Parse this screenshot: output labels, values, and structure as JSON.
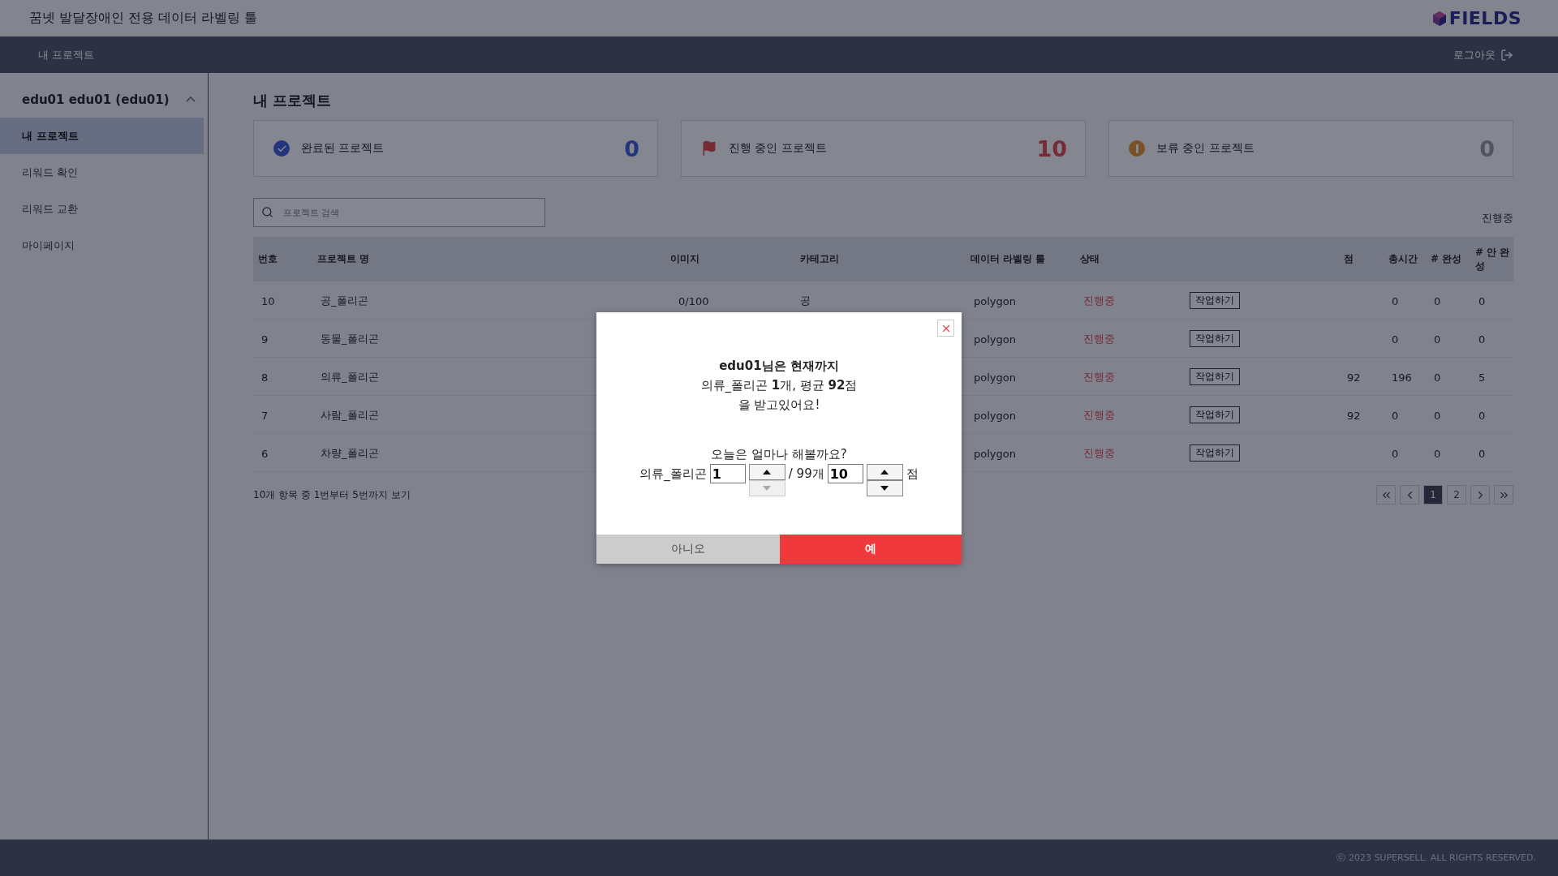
{
  "header": {
    "title": "꿈넷 발달장애인 전용 데이터 라벨링 툴",
    "logo": "FIELDS"
  },
  "navbar": {
    "breadcrumb": "내 프로젝트",
    "logout": "로그아웃"
  },
  "sidebar": {
    "user": "edu01 edu01 (edu01)",
    "expanded": true,
    "items": [
      {
        "label": "내 프로젝트",
        "selected": true
      },
      {
        "label": "리워드 확인",
        "selected": false
      },
      {
        "label": "리워드 교환",
        "selected": false
      },
      {
        "label": "마이페이지",
        "selected": false
      }
    ]
  },
  "page_title": "내 프로젝트",
  "summary_cards": [
    {
      "kind": "done",
      "label": "완료된 프로젝트",
      "count": "0"
    },
    {
      "kind": "progress",
      "label": "진행 중인 프로젝트",
      "count": "10"
    },
    {
      "kind": "hold",
      "label": "보류 중인 프로젝트",
      "count": "0"
    }
  ],
  "search": {
    "placeholder": "프로젝트 검색"
  },
  "filter": "진행중",
  "table": {
    "columns": [
      "번호",
      "프로젝트 명",
      "이미지",
      "카테고리",
      "데이터 라벨링 툴",
      "상태",
      "",
      "점",
      "총시간",
      "# 완성",
      "# 안 완성"
    ],
    "rows": [
      {
        "cells": [
          "10",
          "공_폴리곤",
          "0/100",
          "공",
          "polygon",
          "진행중",
          "작업하기",
          "",
          "0",
          "0",
          "0"
        ]
      },
      {
        "cells": [
          "9",
          "동물_폴리곤",
          "",
          "",
          "polygon",
          "진행중",
          "작업하기",
          "",
          "0",
          "0",
          "0"
        ]
      },
      {
        "cells": [
          "8",
          "의류_폴리곤",
          "",
          "",
          "polygon",
          "진행중",
          "작업하기",
          "92",
          "196",
          "0",
          "5"
        ]
      },
      {
        "cells": [
          "7",
          "사람_폴리곤",
          "",
          "",
          "polygon",
          "진행중",
          "작업하기",
          "92",
          "0",
          "0",
          "0"
        ]
      },
      {
        "cells": [
          "6",
          "차량_폴리곤",
          "",
          "",
          "polygon",
          "진행중",
          "작업하기",
          "",
          "0",
          "0",
          "0"
        ]
      }
    ]
  },
  "table_info": "10개 항목 중 1번부터 5번까지 보기",
  "pagination": [
    {
      "kind": "first",
      "selected": false
    },
    {
      "kind": "prev",
      "selected": false
    },
    {
      "kind": "page",
      "label": "1",
      "selected": true
    },
    {
      "kind": "page",
      "label": "2",
      "selected": false
    },
    {
      "kind": "next",
      "selected": false
    },
    {
      "kind": "last",
      "selected": false
    }
  ],
  "footer": "ⓒ 2023 SUPERSELL. ALL RIGHTS RESERVED.",
  "modal": {
    "lines": [
      "edu01님은 현재까지",
      "의류_폴리곤 **1**개, 평균 **92**점",
      "을 받고있어요!"
    ],
    "question": "오늘은 얼마나 해볼까요?",
    "project": "의류_폴리곤",
    "spinners": [
      {
        "value": "1",
        "up_disabled": false,
        "down_disabled": true
      },
      {
        "value": "10",
        "up_disabled": false,
        "down_disabled": false
      }
    ],
    "total": "/ 99개",
    "unit": "점",
    "buttons": [
      {
        "kind": "cancel",
        "label": "아니오"
      },
      {
        "kind": "confirm",
        "label": "예"
      }
    ]
  }
}
